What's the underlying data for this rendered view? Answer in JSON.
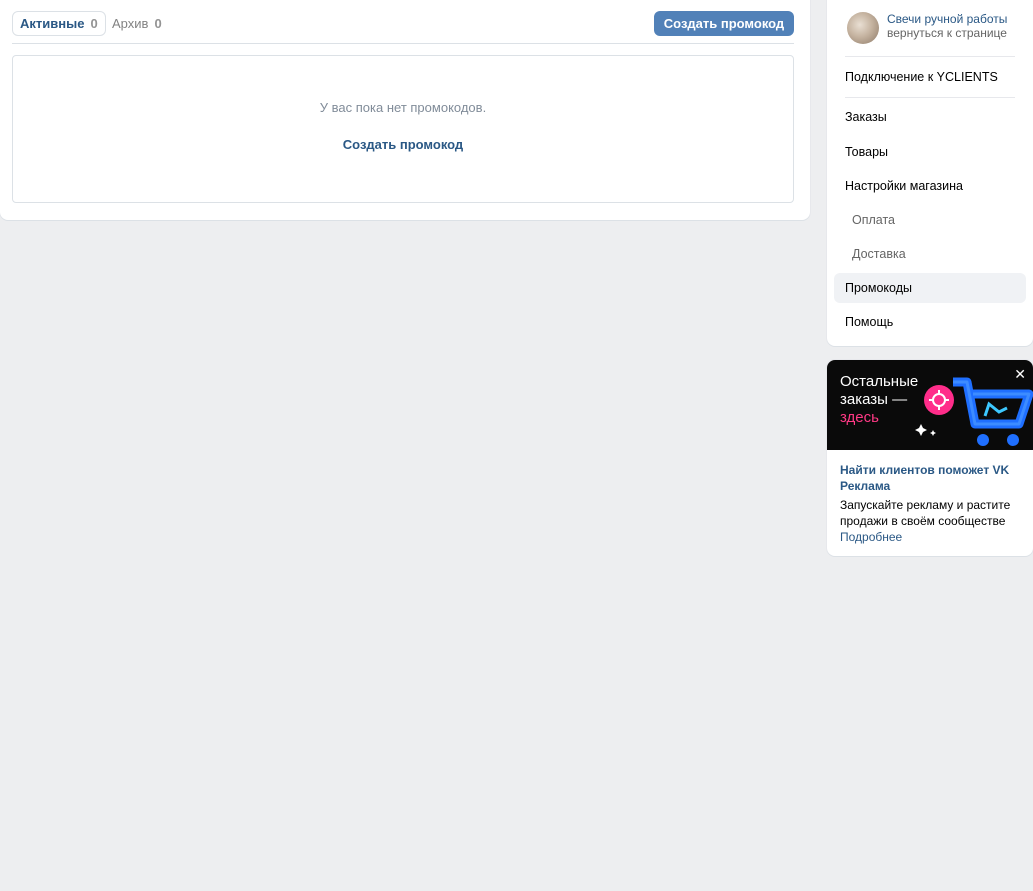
{
  "tabs": [
    {
      "label": "Активные",
      "count": "0"
    },
    {
      "label": "Архив",
      "count": "0"
    }
  ],
  "create_button": "Создать промокод",
  "empty_state": {
    "message": "У вас пока нет промокодов.",
    "link": "Создать промокод"
  },
  "sidebar": {
    "community_name": "Свечи ручной работы",
    "back_link": "вернуться к странице",
    "items": [
      {
        "label": "Подключение к YCLIENTS"
      },
      {
        "label": "Заказы"
      },
      {
        "label": "Товары"
      },
      {
        "label": "Настройки магазина"
      },
      {
        "label": "Оплата"
      },
      {
        "label": "Доставка"
      },
      {
        "label": "Промокоды"
      },
      {
        "label": "Помощь"
      }
    ]
  },
  "promo": {
    "banner_line1": "Остальные",
    "banner_line2": "заказы —",
    "banner_line3": "здесь",
    "title": "Найти клиентов поможет VK Реклама",
    "description": "Запускайте рекламу и растите продажи в своём сообществе",
    "more_link": "Подробнее"
  },
  "colors": {
    "accent": "#5181b8",
    "link": "#2a5885",
    "background": "#edeef0",
    "banner_accent": "#ff3985"
  }
}
